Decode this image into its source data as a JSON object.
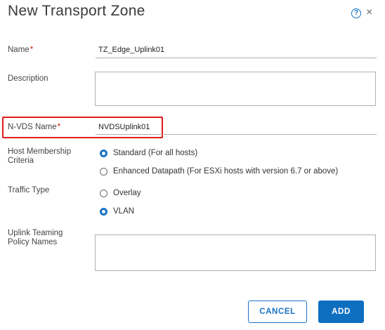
{
  "dialog": {
    "title": "New Transport Zone",
    "help_icon": "?",
    "close_icon": "×"
  },
  "form": {
    "name": {
      "label": "Name",
      "required_mark": "*",
      "value": "TZ_Edge_Uplink01"
    },
    "description": {
      "label": "Description",
      "value": ""
    },
    "nvds_name": {
      "label": "N-VDS Name",
      "required_mark": "*",
      "value": "NVDSUplink01"
    },
    "host_membership": {
      "label_line1": "Host Membership",
      "label_line2": "Criteria",
      "options": [
        {
          "label": "Standard (For all hosts)",
          "selected": true
        },
        {
          "label": "Enhanced Datapath (For ESXi hosts with version 6.7 or above)",
          "selected": false
        }
      ]
    },
    "traffic_type": {
      "label": "Traffic Type",
      "options": [
        {
          "label": "Overlay",
          "selected": false
        },
        {
          "label": "VLAN",
          "selected": true
        }
      ]
    },
    "uplink_teaming": {
      "label_line1": "Uplink Teaming",
      "label_line2": "Policy Names",
      "value": ""
    }
  },
  "footer": {
    "cancel_label": "CANCEL",
    "add_label": "ADD"
  },
  "colors": {
    "accent": "#1a73c6",
    "primary_button": "#0e6fc1",
    "required": "#c92100",
    "highlight_box": "#e01b1b"
  },
  "icons": [
    "help-icon",
    "close-icon",
    "radio-selected",
    "radio-unselected"
  ]
}
